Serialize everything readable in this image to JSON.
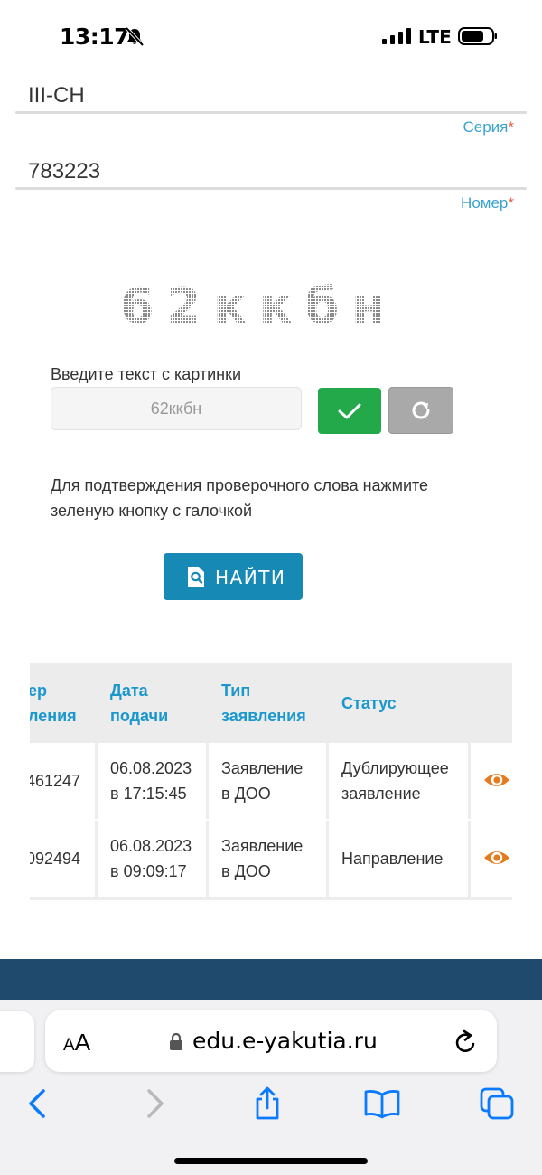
{
  "status_bar": {
    "time": "13:17",
    "network": "LTE",
    "icons": [
      "bell-slash-icon",
      "signal-icon",
      "battery-icon"
    ]
  },
  "form": {
    "series": {
      "value": "III-CH",
      "label": "Серия",
      "required_mark": "*"
    },
    "number": {
      "value": "783223",
      "label": "Номер",
      "required_mark": "*"
    }
  },
  "captcha": {
    "image_text": "62ккбн",
    "prompt": "Введите текст с картинки",
    "input_value": "62ккбн",
    "confirm_icon": "checkmark-icon",
    "refresh_icon": "refresh-icon"
  },
  "hint_text": "Для подтверждения проверочного слова нажмите зеленую кнопку с галочкой",
  "search_button": {
    "label": "НАЙТИ",
    "icon": "search-document-icon"
  },
  "table": {
    "headers": [
      {
        "line1": "ер",
        "line2": "ления"
      },
      {
        "line1": "Дата",
        "line2": "подачи"
      },
      {
        "line1": "Тип",
        "line2": "заявления"
      },
      {
        "line1": "Статус",
        "line2": ""
      }
    ],
    "rows": [
      {
        "number": "461247",
        "date_line1": "06.08.2023",
        "date_line2": "в 17:15:45",
        "type_line1": "Заявление",
        "type_line2": "в ДОО",
        "status_line1": "Дублирующее",
        "status_line2": "заявление",
        "action_icon": "eye-icon"
      },
      {
        "number": "092494",
        "date_line1": "06.08.2023",
        "date_line2": "в 09:09:17",
        "type_line1": "Заявление",
        "type_line2": "в ДОО",
        "status_line1": "Направление",
        "status_line2": "",
        "action_icon": "eye-icon"
      }
    ]
  },
  "browser": {
    "text_size_small": "A",
    "text_size_large": "A",
    "url": "edu.e-yakutia.ru",
    "toolbar": [
      "back-icon",
      "forward-icon",
      "share-icon",
      "bookmarks-icon",
      "tabs-icon"
    ]
  },
  "colors": {
    "accent_blue": "#1689b4",
    "label_blue": "#3aa3cf",
    "header_blue": "#1a97cc",
    "confirm_green": "#23a84a",
    "required_red": "#e0623a",
    "eye_orange": "#e57b1f",
    "footer_navy": "#1f4a6d",
    "safari_blue": "#0a7aff"
  }
}
